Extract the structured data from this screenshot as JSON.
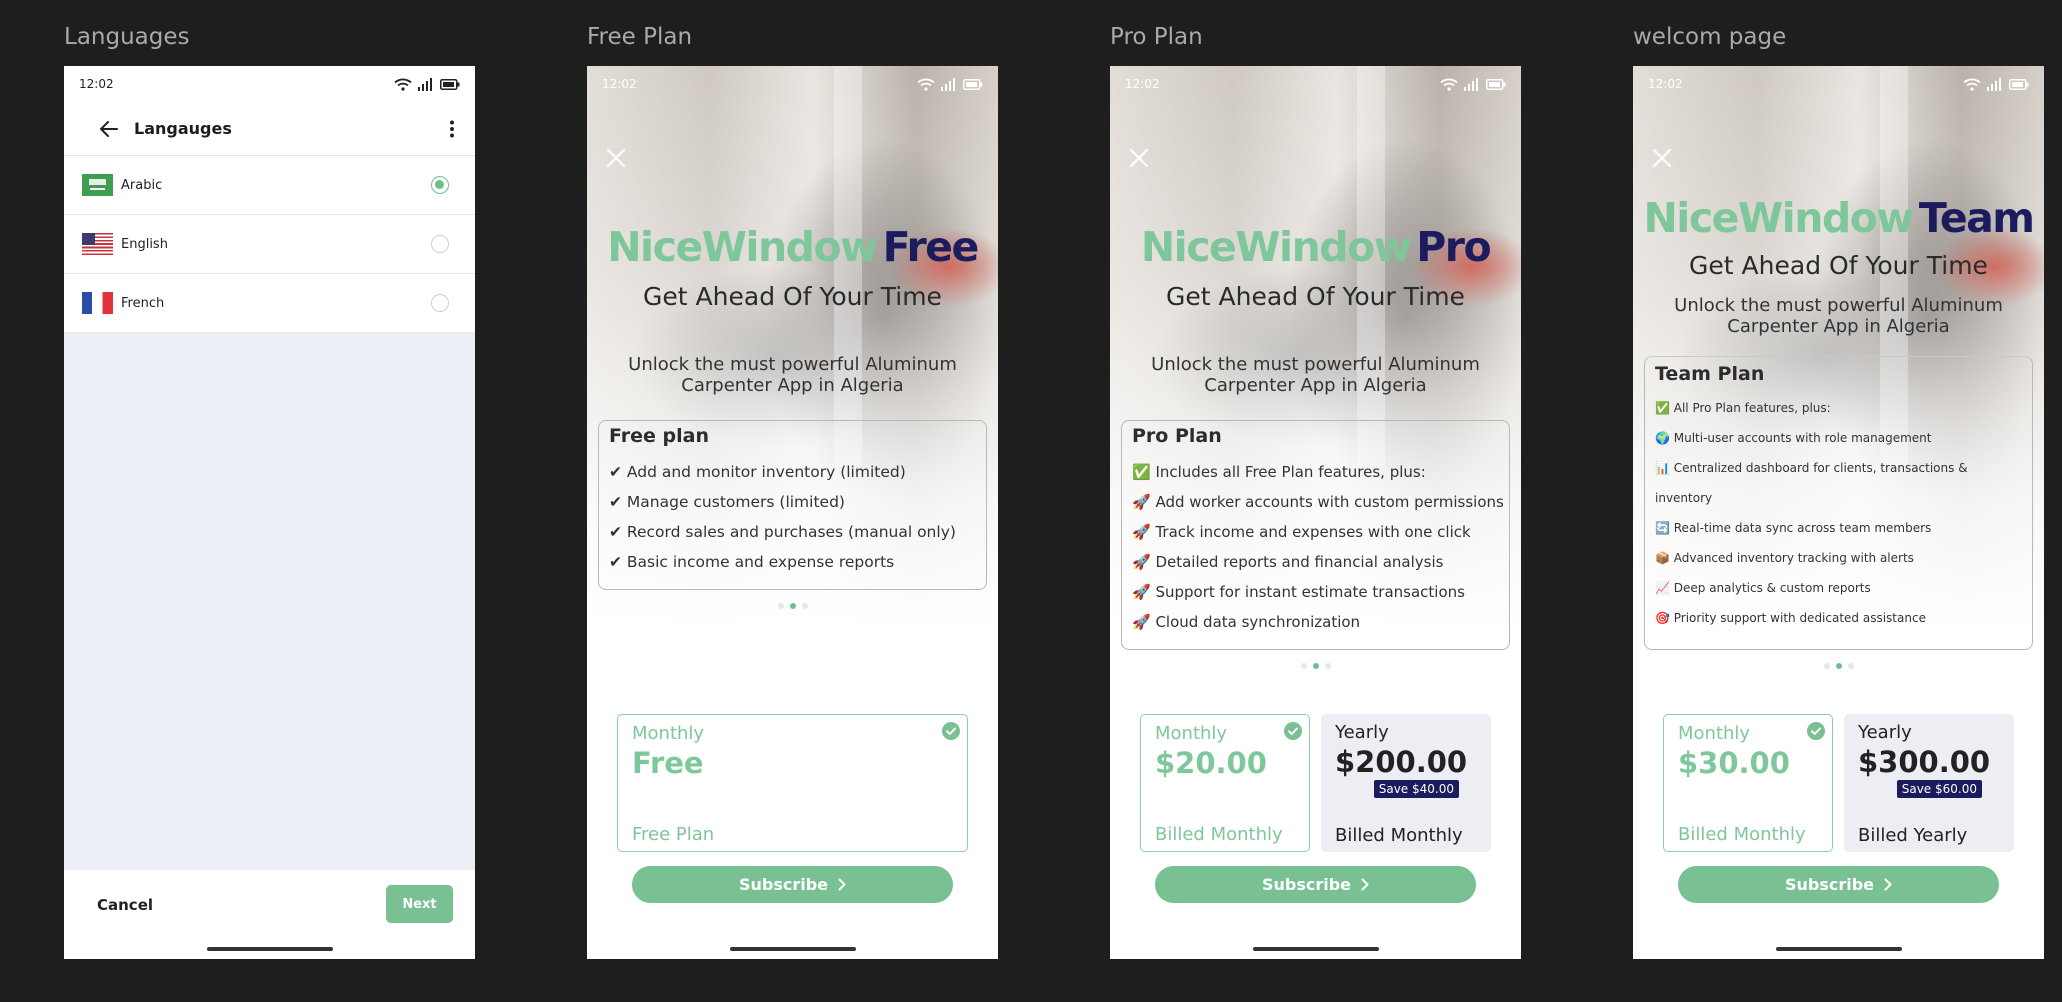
{
  "frames": {
    "languages": "Languages",
    "free": "Free Plan",
    "pro": "Pro Plan",
    "team": "welcom page"
  },
  "status_time": "12:02",
  "languages_screen": {
    "title": "Langauges",
    "options": [
      {
        "label": "Arabic",
        "selected": true,
        "flag": "saudi-flag-icon"
      },
      {
        "label": "English",
        "selected": false,
        "flag": "us-flag-icon"
      },
      {
        "label": "French",
        "selected": false,
        "flag": "france-flag-icon"
      }
    ],
    "cancel_label": "Cancel",
    "next_label": "Next"
  },
  "brand": "NiceWindow",
  "tagline": "Get Ahead Of Your Time",
  "subtagline": "Unlock the must powerful Aluminum Carpenter App in Algeria",
  "subscribe_label": "Subscribe",
  "free_plan": {
    "brand_suffix": "Free",
    "card_title": "Free plan",
    "features": [
      "✔ Add and monitor inventory (limited)",
      "✔ Manage customers (limited)",
      "✔ Record sales and purchases (manual only)",
      "✔ Basic income and expense reports"
    ],
    "price": {
      "period": "Monthly",
      "amount": "Free",
      "billed": "Free Plan"
    }
  },
  "pro_plan": {
    "brand_suffix": "Pro",
    "card_title": "Pro Plan",
    "features": [
      "✅ Includes all Free Plan features, plus:",
      "🚀 Add worker accounts with custom permissions",
      "🚀 Track income and expenses with one click",
      "🚀 Detailed reports and financial analysis",
      "🚀 Support for instant estimate transactions",
      "🚀 Cloud data synchronization"
    ],
    "monthly": {
      "period": "Monthly",
      "amount": "$20.00",
      "billed": "Billed Monthly"
    },
    "yearly": {
      "period": "Yearly",
      "amount": "$200.00",
      "save": "Save $40.00",
      "billed": "Billed Monthly"
    }
  },
  "team_plan": {
    "brand_suffix": "Team",
    "card_title": "Team Plan",
    "features": [
      "✅ All Pro Plan features, plus:",
      "🌍 Multi-user accounts with role management",
      "📊 Centralized dashboard for clients, transactions & inventory",
      "🔄 Real-time data sync across team members",
      "📦 Advanced inventory tracking with alerts",
      "📈 Deep analytics & custom reports",
      "🎯 Priority support with dedicated assistance"
    ],
    "monthly": {
      "period": "Monthly",
      "amount": "$30.00",
      "billed": "Billed Monthly"
    },
    "yearly": {
      "period": "Yearly",
      "amount": "$300.00",
      "save": "Save $60.00",
      "billed": "Billed Yearly"
    }
  },
  "colors": {
    "accent": "#79c192",
    "brand_dark": "#1b1b5e",
    "canvas": "#1e1e1e"
  }
}
